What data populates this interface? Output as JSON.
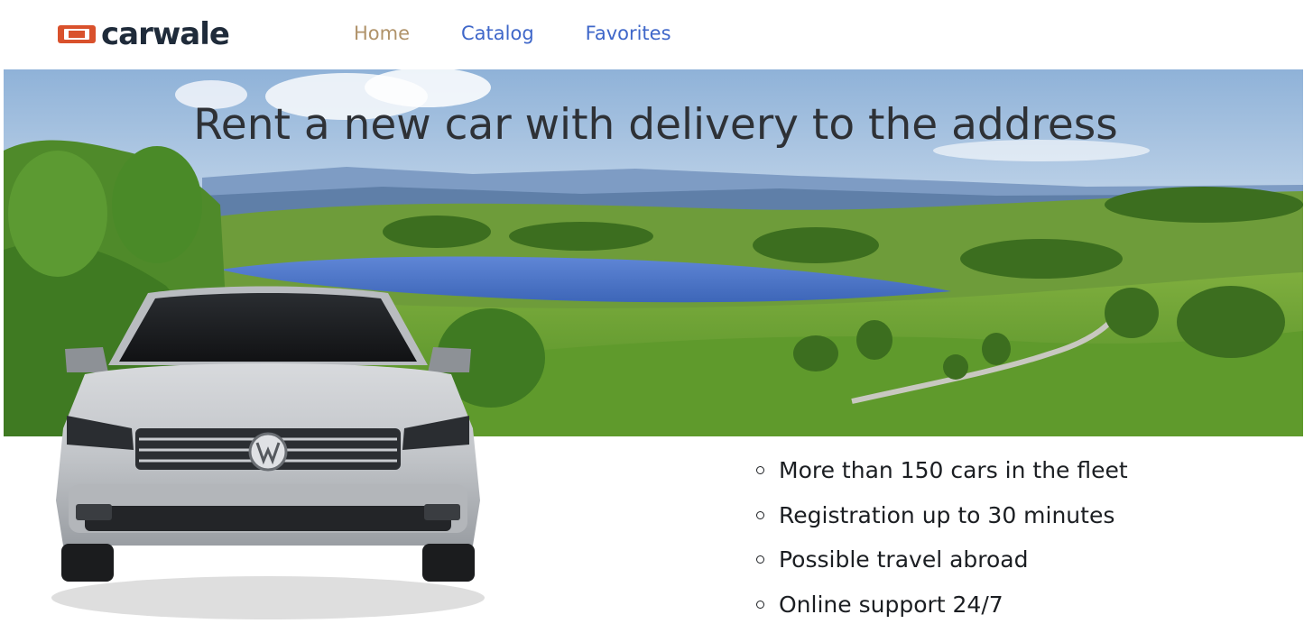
{
  "header": {
    "logo_text": "carwale",
    "nav": {
      "home": "Home",
      "catalog": "Catalog",
      "favorites": "Favorites"
    }
  },
  "hero": {
    "title": "Rent a new car with delivery to the address"
  },
  "features": [
    "More than 150 cars in the fleet",
    "Registration up to 30 minutes",
    "Possible travel abroad",
    "Online support 24/7"
  ],
  "colors": {
    "nav_active": "#b0936a",
    "nav_link": "#3f67c9",
    "logo_mark": "#d9512c",
    "logo_text": "#1f2b3a",
    "text": "#1b1e22"
  },
  "icons": {
    "logo": "carwale-logo-icon",
    "bullet": "circle-bullet-icon",
    "car": "volkswagen-car-image"
  }
}
